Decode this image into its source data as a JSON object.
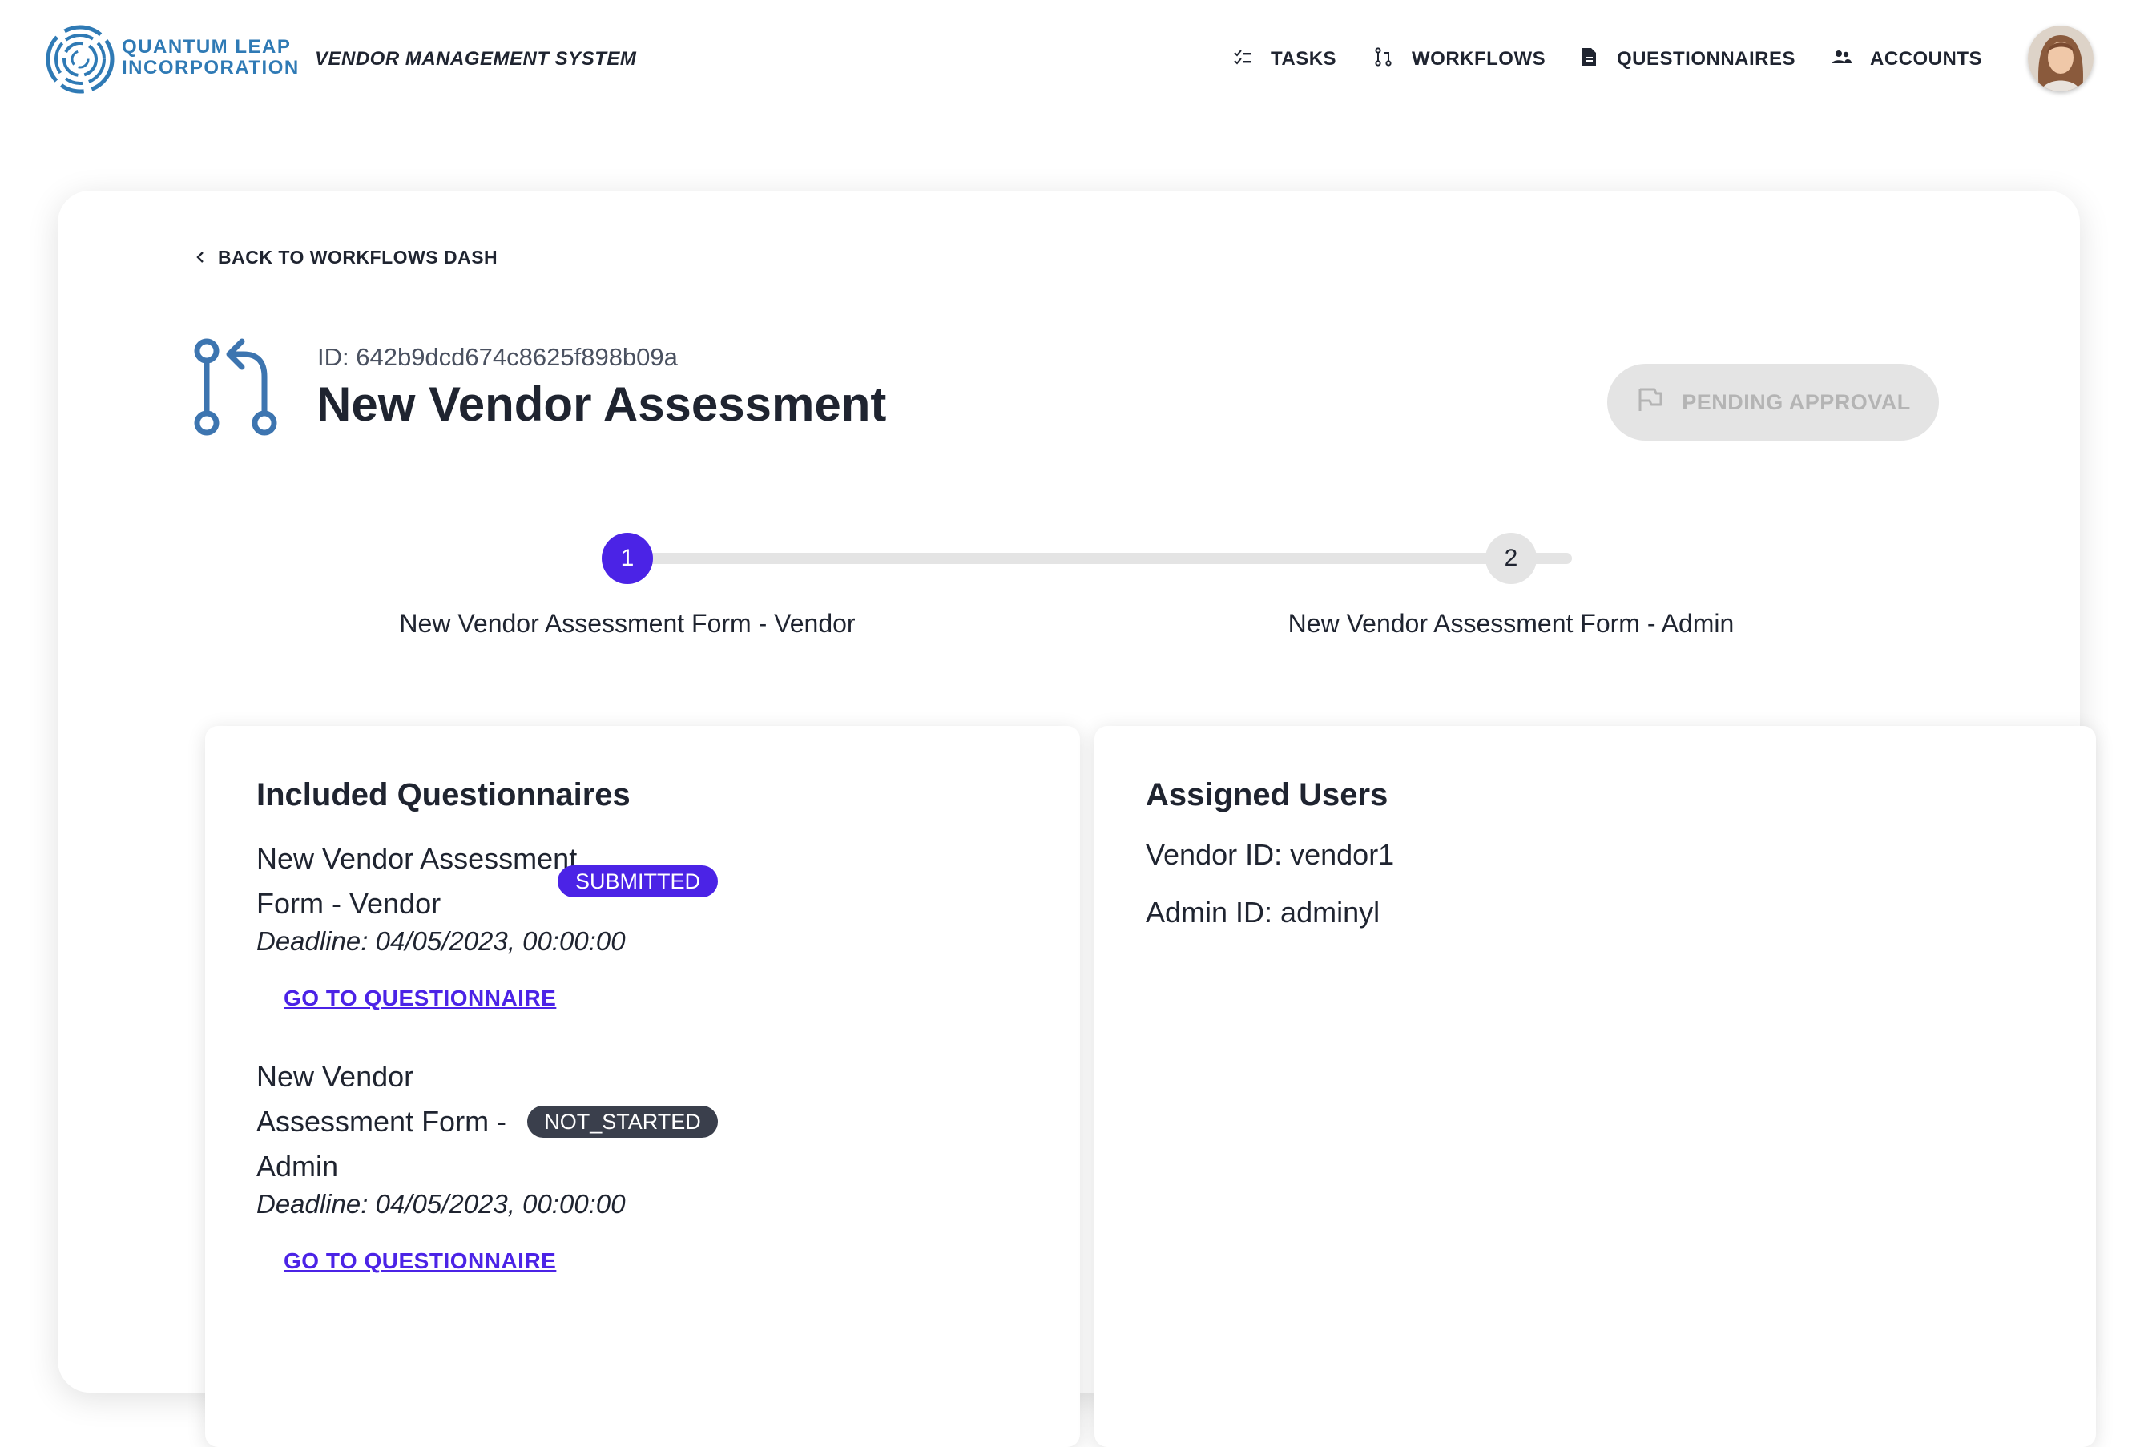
{
  "header": {
    "logo_line1": "QUANTUM LEAP",
    "logo_line2": "INCORPORATION",
    "app_name": "VENDOR MANAGEMENT SYSTEM",
    "nav": [
      {
        "label": "TASKS",
        "icon": "checklist-icon"
      },
      {
        "label": "WORKFLOWS",
        "icon": "workflow-icon"
      },
      {
        "label": "QUESTIONNAIRES",
        "icon": "document-icon"
      },
      {
        "label": "ACCOUNTS",
        "icon": "people-icon"
      }
    ]
  },
  "workflow": {
    "back_label": "BACK TO WORKFLOWS DASH",
    "id_text": "ID: 642b9dcd674c8625f898b09a",
    "title": "New Vendor Assessment",
    "status_button": "PENDING APPROVAL"
  },
  "stepper": {
    "steps": [
      {
        "number": "1",
        "label": "New Vendor Assessment Form - Vendor",
        "active": true
      },
      {
        "number": "2",
        "label": "New Vendor Assessment Form - Admin",
        "active": false
      }
    ]
  },
  "questionnaires": {
    "title": "Included Questionnaires",
    "items": [
      {
        "name": "New Vendor Assessment Form - Vendor",
        "status": "SUBMITTED",
        "deadline": "Deadline: 04/05/2023, 00:00:00",
        "link": "GO TO QUESTIONNAIRE"
      },
      {
        "name": "New Vendor Assessment Form - Admin",
        "status": "NOT_STARTED",
        "deadline": "Deadline: 04/05/2023, 00:00:00",
        "link": "GO TO QUESTIONNAIRE"
      }
    ]
  },
  "assigned_users": {
    "title": "Assigned Users",
    "vendor": "Vendor ID: vendor1",
    "admin": "Admin ID: adminyl"
  },
  "colors": {
    "accent": "#4b23e6",
    "brand": "#2f7ab5",
    "badge_dark": "#3a3f4c",
    "disabled": "#e4e4e4"
  }
}
